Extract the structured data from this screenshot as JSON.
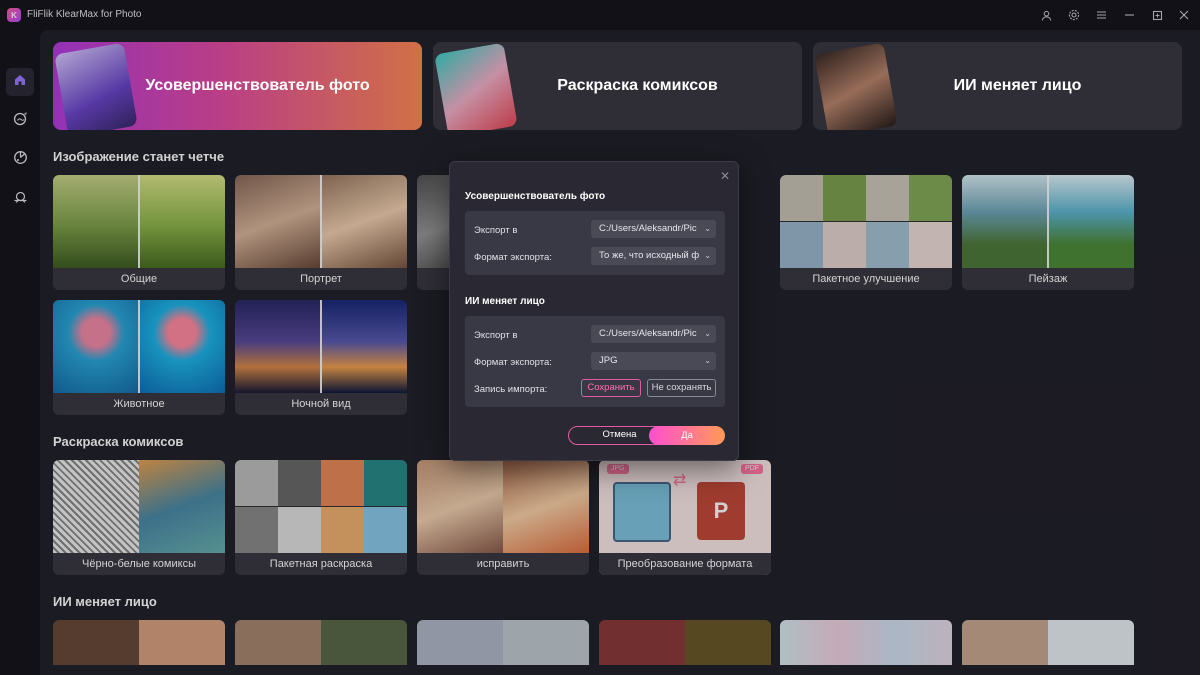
{
  "app": {
    "title": "FliFlik KlearMax for Photo",
    "logo_text": "K",
    "accent_color": "#ff5fa0"
  },
  "window_controls": [
    {
      "name": "account-icon",
      "glyph": "👤"
    },
    {
      "name": "settings-icon",
      "glyph": "⚙"
    },
    {
      "name": "menu-icon",
      "glyph": "☰"
    },
    {
      "name": "minimize-icon",
      "glyph": "—"
    },
    {
      "name": "maximize-icon",
      "glyph": "⧉"
    },
    {
      "name": "close-icon",
      "glyph": "✕"
    }
  ],
  "sidebar": {
    "items": [
      {
        "name": "home-icon",
        "active": true
      },
      {
        "name": "enhance-icon",
        "active": false
      },
      {
        "name": "colorize-icon",
        "active": false
      },
      {
        "name": "face-swap-icon",
        "active": false
      }
    ]
  },
  "banners": [
    {
      "label": "Усовершенствователь фото"
    },
    {
      "label": "Раскраска комиксов"
    },
    {
      "label": "ИИ меняет лицо"
    }
  ],
  "sections": {
    "clearer": "Изображение станет четче",
    "comics": "Раскраска комиксов",
    "face": "ИИ меняет лицо"
  },
  "clearer_cards": [
    {
      "label": "Общие"
    },
    {
      "label": "Портрет"
    },
    {
      "label": "Пакетное улучшение"
    },
    {
      "label": "Пейзаж"
    },
    {
      "label": "Животное"
    },
    {
      "label": "Ночной вид"
    }
  ],
  "comic_cards": [
    {
      "label": "Чёрно-белые комиксы"
    },
    {
      "label": "Пакетная раскраска"
    },
    {
      "label": "исправить"
    },
    {
      "label": "Преобразование формата",
      "tag_left": "JPG",
      "tag_right": "PDF"
    }
  ],
  "dialog": {
    "section1": {
      "title": "Усовершенствователь фото",
      "export_label": "Экспорт в",
      "export_value": "C:/Users/Aleksandr/Pic",
      "format_label": "Формат экспорта:",
      "format_value": "То же, что исходный ф"
    },
    "section2": {
      "title": "ИИ меняет лицо",
      "export_label": "Экспорт в",
      "export_value": "C:/Users/Aleksandr/Pic",
      "format_label": "Формат экспорта:",
      "format_value": "JPG",
      "record_label": "Запись импорта:",
      "save_label": "Сохранить",
      "nosave_label": "Не сохранять"
    },
    "cancel_label": "Отмена",
    "ok_label": "Да"
  }
}
